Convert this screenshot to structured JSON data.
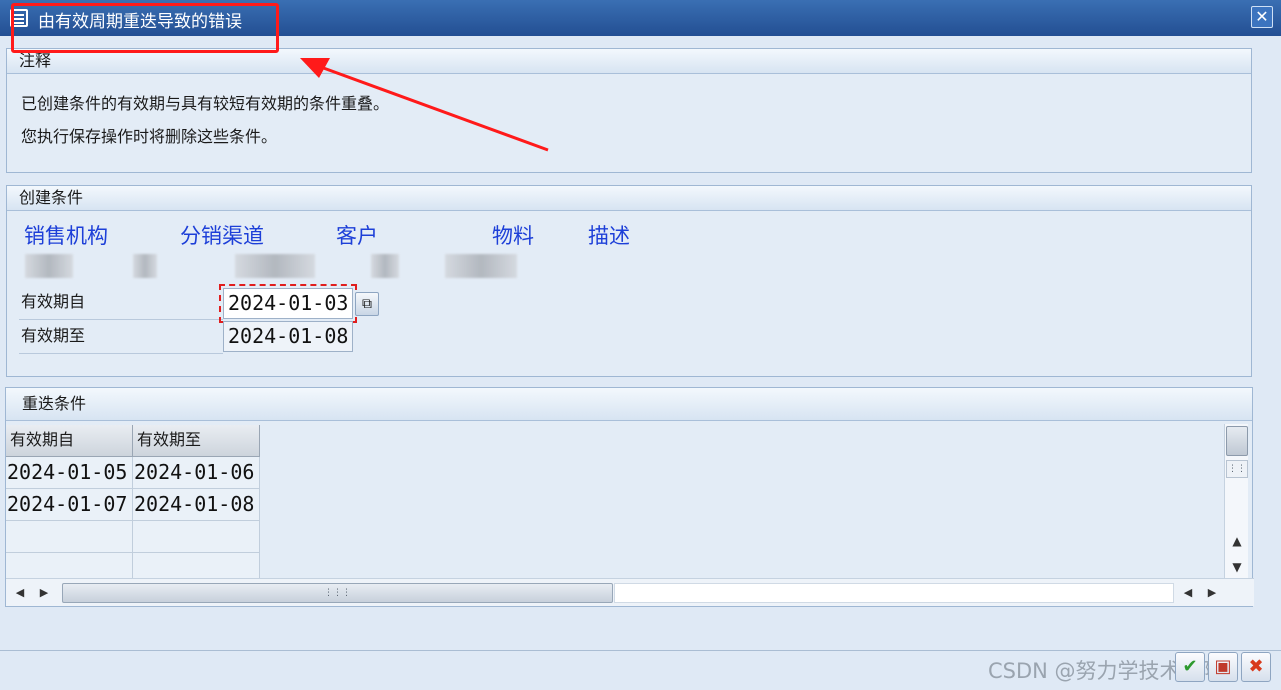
{
  "dialog": {
    "title": "由有效周期重迭导致的错误",
    "close_symbol": "✕"
  },
  "notes": {
    "header": "注释",
    "line1": "已创建条件的有效期与具有较短有效期的条件重叠。",
    "line2": "您执行保存操作时将删除这些条件。"
  },
  "create_conditions": {
    "header": "创建条件",
    "columns": [
      "销售机构",
      "分销渠道",
      "客户",
      "物料",
      "描述"
    ],
    "valid_from_label": "有效期自",
    "valid_from_value": "2024-01-03",
    "valid_to_label": "有效期至",
    "valid_to_value": "2024-01-08"
  },
  "overlap_conditions": {
    "header": "重迭条件",
    "columns": [
      "有效期自",
      "有效期至"
    ],
    "rows": [
      [
        "2024-01-05",
        "2024-01-06"
      ],
      [
        "2024-01-07",
        "2024-01-08"
      ]
    ]
  },
  "watermark": "CSDN @努力学技术的阿K",
  "colors": {
    "annotation": "#ff1a1a",
    "header_text": "#1d3fd8",
    "title_bar": "#2a5a9f"
  }
}
